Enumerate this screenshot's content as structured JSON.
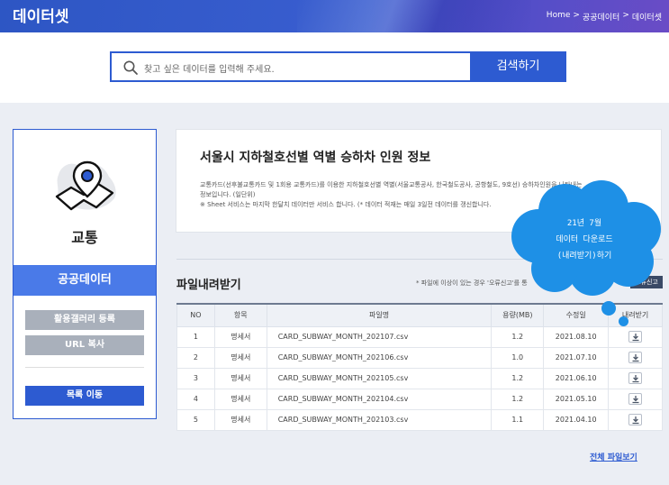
{
  "header": {
    "title": "데이터셋",
    "breadcrumb": [
      "Home",
      ">",
      "공공데이터",
      ">",
      "데이터셋"
    ]
  },
  "search": {
    "placeholder": "찾고 싶은 데이터를 입력해 주세요.",
    "button_label": "검색하기"
  },
  "sidebar": {
    "category_icon": "map-pin-icon",
    "category": "교통",
    "section_label": "공공데이터",
    "gallery_button": "활용갤러리 등록",
    "url_copy_button": "URL 복사",
    "list_button": "목록 이동"
  },
  "dataset": {
    "title": "서울시 지하철호선별 역별 승하차 인원 정보",
    "desc_line1": "교통카드(선후불교통카드 및 1회용 교통카드)를 이용한 지하철호선별 역별(서울교통공사, 한국철도공사, 공항철도, 9호선) 승하차인원을 나타내는",
    "desc_line2": "정보입니다. (일단위)",
    "desc_line3": "※ Sheet 서비스는 마지막 한달치 데이터만 서비스 합니다. (* 데이터 적재는 매일 3일전 데이터를 갱신합니다."
  },
  "annotation": {
    "line1": "21년 7월",
    "line2": "데이터 다운로드",
    "line3": "(내려받기)하기",
    "color": "#1e90e6"
  },
  "download": {
    "title": "파일내려받기",
    "note": "* 파일에 이상이 있는 경우 '오류신고'를 통",
    "report_button": "오류신고",
    "columns": [
      "NO",
      "항목",
      "파일명",
      "용량(MB)",
      "수정일",
      "내려받기"
    ],
    "rows": [
      {
        "no": "1",
        "type": "명세서",
        "filename": "CARD_SUBWAY_MONTH_202107.csv",
        "size": "1.2",
        "date": "2021.08.10"
      },
      {
        "no": "2",
        "type": "명세서",
        "filename": "CARD_SUBWAY_MONTH_202106.csv",
        "size": "1.0",
        "date": "2021.07.10"
      },
      {
        "no": "3",
        "type": "명세서",
        "filename": "CARD_SUBWAY_MONTH_202105.csv",
        "size": "1.2",
        "date": "2021.06.10"
      },
      {
        "no": "4",
        "type": "명세서",
        "filename": "CARD_SUBWAY_MONTH_202104.csv",
        "size": "1.2",
        "date": "2021.05.10"
      },
      {
        "no": "5",
        "type": "명세서",
        "filename": "CARD_SUBWAY_MONTH_202103.csv",
        "size": "1.1",
        "date": "2021.04.10"
      }
    ],
    "all_files_link": "전체 파일보기"
  },
  "colors": {
    "primary": "#2d5bd1",
    "accent_band": "#4a7ae8",
    "gray_button": "#a9b0bb"
  }
}
